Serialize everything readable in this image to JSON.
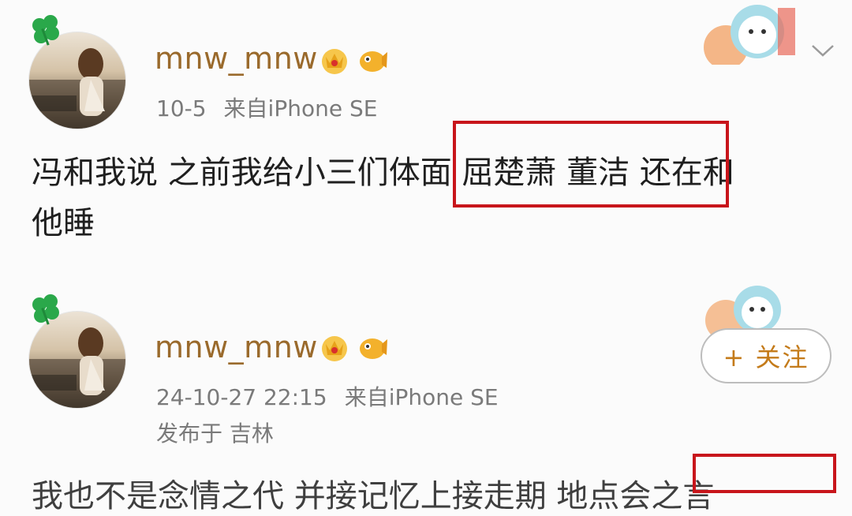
{
  "posts": [
    {
      "username": "mnw_mnw",
      "date": "10-5",
      "source": "来自iPhone SE",
      "content_line1": "冯和我说 之前我给小三们体面 屈楚萧 董洁 还在和",
      "content_line2": "他睡"
    },
    {
      "username": "mnw_mnw",
      "date": "24-10-27 22:15",
      "source": "来自iPhone SE",
      "location": "发布于 吉林",
      "follow_label": "+ 关注",
      "content_partial": "我也不是念情之代 并接记忆上接走期 地点会之言"
    }
  ],
  "colors": {
    "username": "#9a6a2c",
    "highlight": "#c8151b",
    "follow_text": "#c47b1a"
  },
  "icons": {
    "badge1": "crown-badge-icon",
    "badge2": "fish-badge-icon",
    "menu": "chevron-down-icon",
    "avatar_deco": "clover-icon",
    "sticker": "cartoon-sticker-icon"
  }
}
